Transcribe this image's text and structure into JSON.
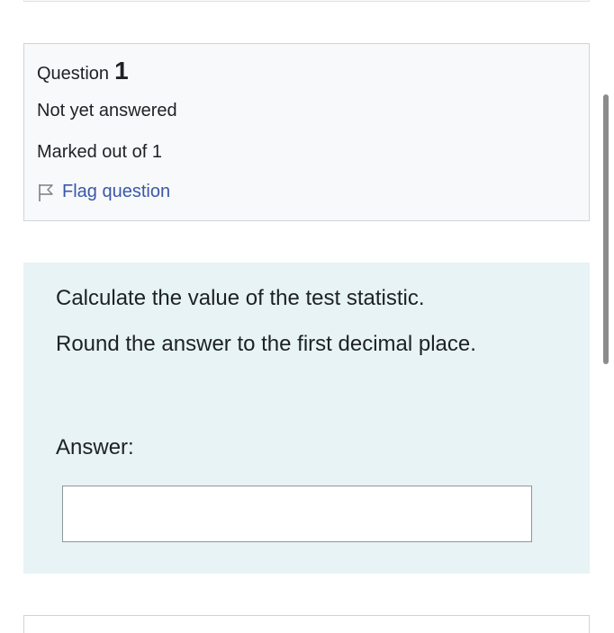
{
  "question_info": {
    "label": "Question",
    "number": "1",
    "state": "Not yet answered",
    "grade": "Marked out of 1",
    "flag_label": "Flag question",
    "flag_icon": "flag-outline-icon"
  },
  "question_body": {
    "prompt_line1": "Calculate the value of the test statistic.",
    "prompt_line2": "Round the answer to the first decimal place.",
    "answer_label": "Answer:",
    "answer_value": ""
  },
  "colors": {
    "info_background": "#f8f9fa",
    "formulation_background": "#e7f3f5",
    "link": "#3a57a8",
    "text": "#1d2125"
  }
}
